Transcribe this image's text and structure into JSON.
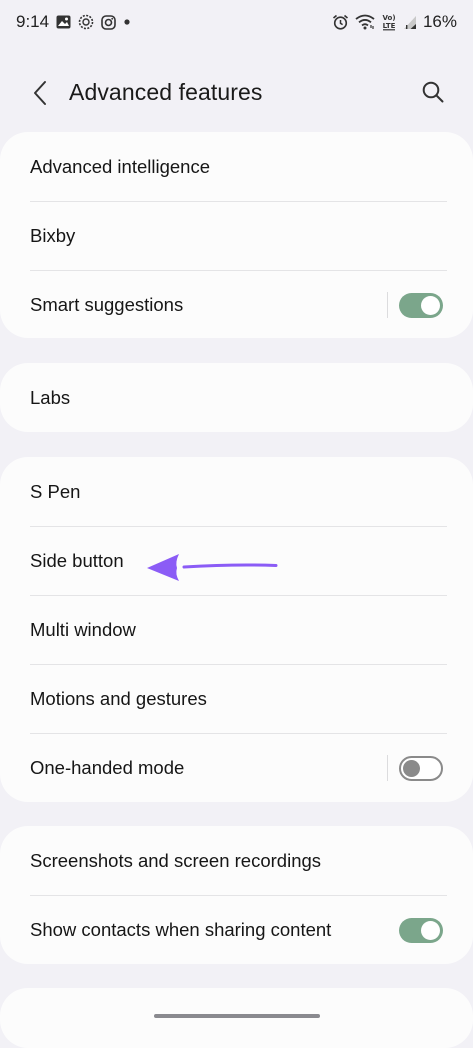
{
  "status_bar": {
    "time": "9:14",
    "battery": "16%",
    "icons": [
      "gallery-icon",
      "sync-icon",
      "instagram-icon",
      "dot-icon",
      "alarm-icon",
      "wifi-icon",
      "volte-icon",
      "signal-icon"
    ]
  },
  "header": {
    "title": "Advanced features",
    "back_icon": "chevron-left-icon",
    "search_icon": "search-icon"
  },
  "groups": [
    {
      "items": [
        {
          "label": "Advanced intelligence"
        },
        {
          "label": "Bixby"
        },
        {
          "label": "Smart suggestions",
          "toggle": "on"
        }
      ]
    },
    {
      "items": [
        {
          "label": "Labs"
        }
      ]
    },
    {
      "items": [
        {
          "label": "S Pen"
        },
        {
          "label": "Side button"
        },
        {
          "label": "Multi window"
        },
        {
          "label": "Motions and gestures"
        },
        {
          "label": "One-handed mode",
          "toggle": "off"
        }
      ]
    },
    {
      "items": [
        {
          "label": "Screenshots and screen recordings"
        },
        {
          "label": "Show contacts when sharing content",
          "toggle": "on"
        }
      ]
    }
  ],
  "colors": {
    "background": "#f2f1f6",
    "card": "#fcfcfc",
    "toggle_on": "#7ba68b",
    "toggle_off_border": "#8a8a8a",
    "annotation_arrow": "#8b5cf6"
  }
}
